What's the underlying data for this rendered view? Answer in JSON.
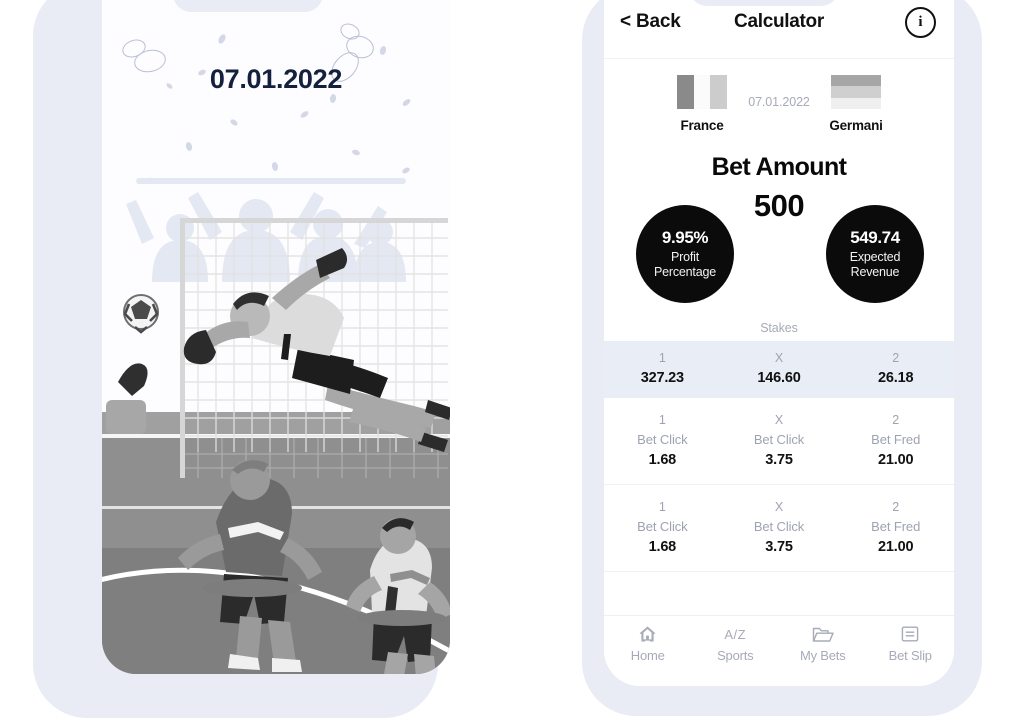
{
  "left_phone": {
    "date": "07.01.2022",
    "illustration": "soccer-goalkeeper-save-illustration"
  },
  "right_phone": {
    "header": {
      "back_label": "< Back",
      "title": "Calculator",
      "info_label": "i"
    },
    "match": {
      "home_team": "France",
      "away_team": "Germani",
      "date": "07.01.2022",
      "home_flag_colors": [
        "#8a8a8a",
        "#fbfbfb",
        "#cccccc"
      ],
      "away_flag_colors": [
        "#a6a6a6",
        "#cfcfcf",
        "#efefef"
      ]
    },
    "bet_amount": {
      "title": "Bet Amount",
      "value": "500",
      "profit_percentage_value": "9.95%",
      "profit_percentage_label": "Profit Percentage",
      "expected_revenue_value": "549.74",
      "expected_revenue_label": "Expected Revenue",
      "stakes_caption": "Stakes"
    },
    "stakes": {
      "columns": [
        "1",
        "X",
        "2"
      ],
      "values": [
        "327.23",
        "146.60",
        "26.18"
      ]
    },
    "bet_cards": [
      {
        "cells": [
          {
            "key": "1",
            "bookmaker": "Bet Click",
            "odds": "1.68"
          },
          {
            "key": "X",
            "bookmaker": "Bet Click",
            "odds": "3.75"
          },
          {
            "key": "2",
            "bookmaker": "Bet Fred",
            "odds": "21.00"
          }
        ]
      },
      {
        "cells": [
          {
            "key": "1",
            "bookmaker": "Bet Click",
            "odds": "1.68"
          },
          {
            "key": "X",
            "bookmaker": "Bet Click",
            "odds": "3.75"
          },
          {
            "key": "2",
            "bookmaker": "Bet Fred",
            "odds": "21.00"
          }
        ]
      }
    ],
    "tab_bar": [
      {
        "icon": "home-icon",
        "label": "Home"
      },
      {
        "icon": "a-z-icon",
        "label": "Sports",
        "icon_text": "A/Z"
      },
      {
        "icon": "folder-icon",
        "label": "My Bets"
      },
      {
        "icon": "receipt-icon",
        "label": "Bet Slip"
      }
    ]
  },
  "colors": {
    "phone_frame": "#e9ecf5",
    "stakes_row_bg": "#e9edf6",
    "circle_bg": "#0b0b0b",
    "muted_text": "#a7abb8",
    "date_navy": "#14213d"
  }
}
